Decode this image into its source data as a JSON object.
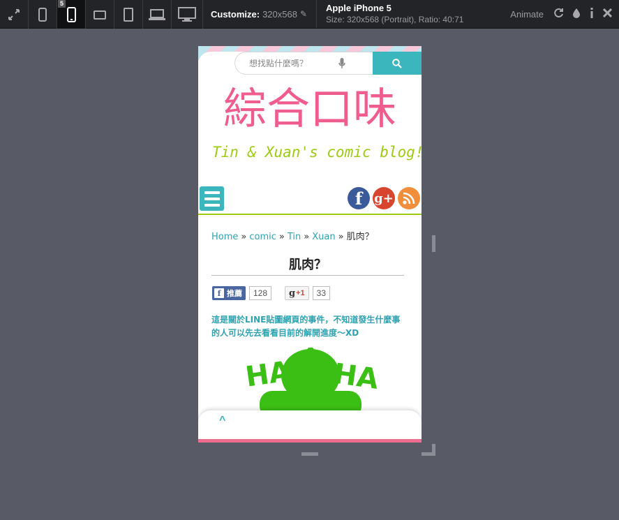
{
  "toolbar": {
    "device_badge": "5",
    "customize_label": "Customize:",
    "customize_value": "320x568",
    "device_name": "Apple iPhone 5",
    "device_size": "Size: 320x568 (Portrait), Ratio: 40:71",
    "animate_label": "Animate",
    "icons": [
      "fullscreen-icon",
      "phone-small-icon",
      "phone-icon",
      "tablet-landscape-icon",
      "tablet-icon",
      "laptop-icon",
      "desktop-icon",
      "pencil-icon",
      "rotate-icon",
      "drop-icon",
      "info-icon",
      "close-icon"
    ]
  },
  "site": {
    "search_placeholder": "想找點什麼嗎？",
    "logo_text": "綜合口味",
    "tagline": "Tin & Xuan's comic blog!",
    "social": {
      "facebook": "f",
      "google": "g+",
      "rss": "rss"
    },
    "breadcrumb": [
      "Home",
      "comic",
      "Tin",
      "Xuan"
    ],
    "breadcrumb_sep": "»",
    "breadcrumb_current": "肌肉？",
    "post_title": "肌肉？",
    "fb_like_label": "推薦",
    "fb_like_count": "128",
    "gplus_label": "+1",
    "gplus_count": "33",
    "intro_text": "這是關於LINE貼圖網頁的事件，不知道發生什麼事的人可以先去看看目前的解開進度～XD",
    "comic_text": "HA HA",
    "back_to_top": "^"
  },
  "colors": {
    "accent_teal": "#3bb6bd",
    "logo_pink": "#ef5d8f",
    "tagline_green": "#9ccb10",
    "link_teal": "#2fa2b0",
    "footer_pink": "#ef6c91",
    "toolbar_bg": "#232427",
    "page_bg": "#585b66"
  }
}
